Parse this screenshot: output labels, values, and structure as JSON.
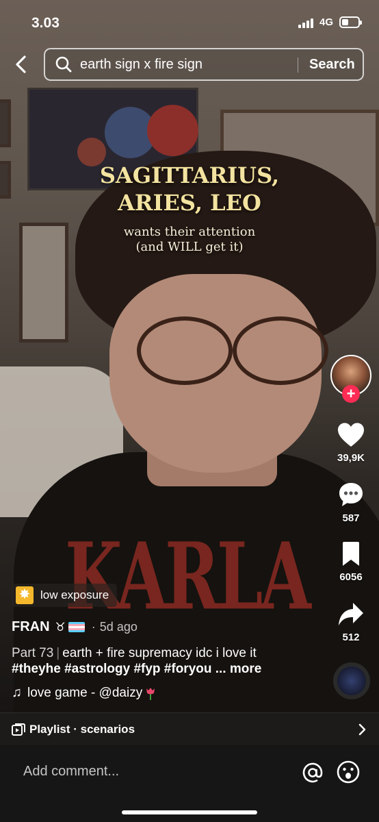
{
  "status_bar": {
    "time": "3.03",
    "network": "4G"
  },
  "header": {
    "search_query": "earth sign x fire sign",
    "search_button": "Search"
  },
  "video": {
    "caption_line1": "SAGITTARIUS,",
    "caption_line2": "ARIES, LEO",
    "caption_line3": "wants their attention",
    "caption_line4": "(and WILL get it)"
  },
  "actions": {
    "likes": "39,9K",
    "comments": "587",
    "bookmarks": "6056",
    "shares": "512"
  },
  "post": {
    "effect_badge": "low exposure",
    "author": "FRAN",
    "author_sign": "♉",
    "age_sep": "·",
    "age": "5d ago",
    "part": "Part 73",
    "description": "earth + fire supremacy idc i love it",
    "hashtags": "#theyhe #astrology #fyp #foryou",
    "more": "... more",
    "sound": "love game - @daizy"
  },
  "playlist": {
    "label": "Playlist · scenarios"
  },
  "comment": {
    "placeholder": "Add comment..."
  },
  "colors": {
    "follow_red": "#fe2c55",
    "caption_gold": "#f3e3a0",
    "badge_yellow": "#f5b82c"
  }
}
